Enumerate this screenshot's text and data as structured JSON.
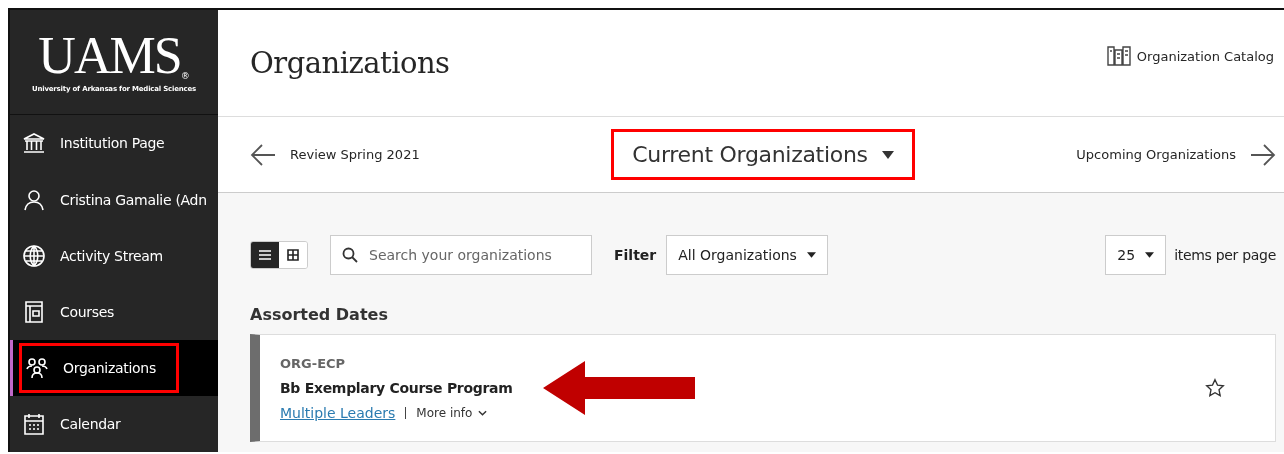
{
  "logo": {
    "wordmark": "UAMS",
    "registered": "®",
    "subtitle": "University of Arkansas for Medical Sciences"
  },
  "sidebar": {
    "items": [
      {
        "kind": "institution",
        "label": "Institution Page",
        "selected": false,
        "highlighted": false
      },
      {
        "kind": "person",
        "label": "Cristina Gamalie (Adn",
        "selected": false,
        "highlighted": false
      },
      {
        "kind": "globe",
        "label": "Activity Stream",
        "selected": false,
        "highlighted": false
      },
      {
        "kind": "courses",
        "label": "Courses",
        "selected": false,
        "highlighted": false
      },
      {
        "kind": "organizations",
        "label": "Organizations",
        "selected": true,
        "highlighted": true
      },
      {
        "kind": "calendar",
        "label": "Calendar",
        "selected": false,
        "highlighted": false
      }
    ]
  },
  "header": {
    "title": "Organizations",
    "catalog_link": "Organization Catalog"
  },
  "term_nav": {
    "previous": "Review Spring 2021",
    "current": "Current Organizations",
    "current_highlighted": true,
    "next": "Upcoming Organizations"
  },
  "toolbar": {
    "views": [
      {
        "kind": "list",
        "selected": true
      },
      {
        "kind": "grid",
        "selected": false
      }
    ],
    "search": {
      "placeholder": "Search your organizations"
    },
    "filter_label": "Filter",
    "filter_value": "All Organizations",
    "page_size": "25",
    "page_size_label": "items per page"
  },
  "section_title": "Assorted Dates",
  "organizations": [
    {
      "code": "ORG-ECP",
      "name": "Bb Exemplary Course Program",
      "leaders": "Multiple Leaders",
      "more": "More info",
      "starred": false,
      "pointer_arrow": true
    }
  ]
}
